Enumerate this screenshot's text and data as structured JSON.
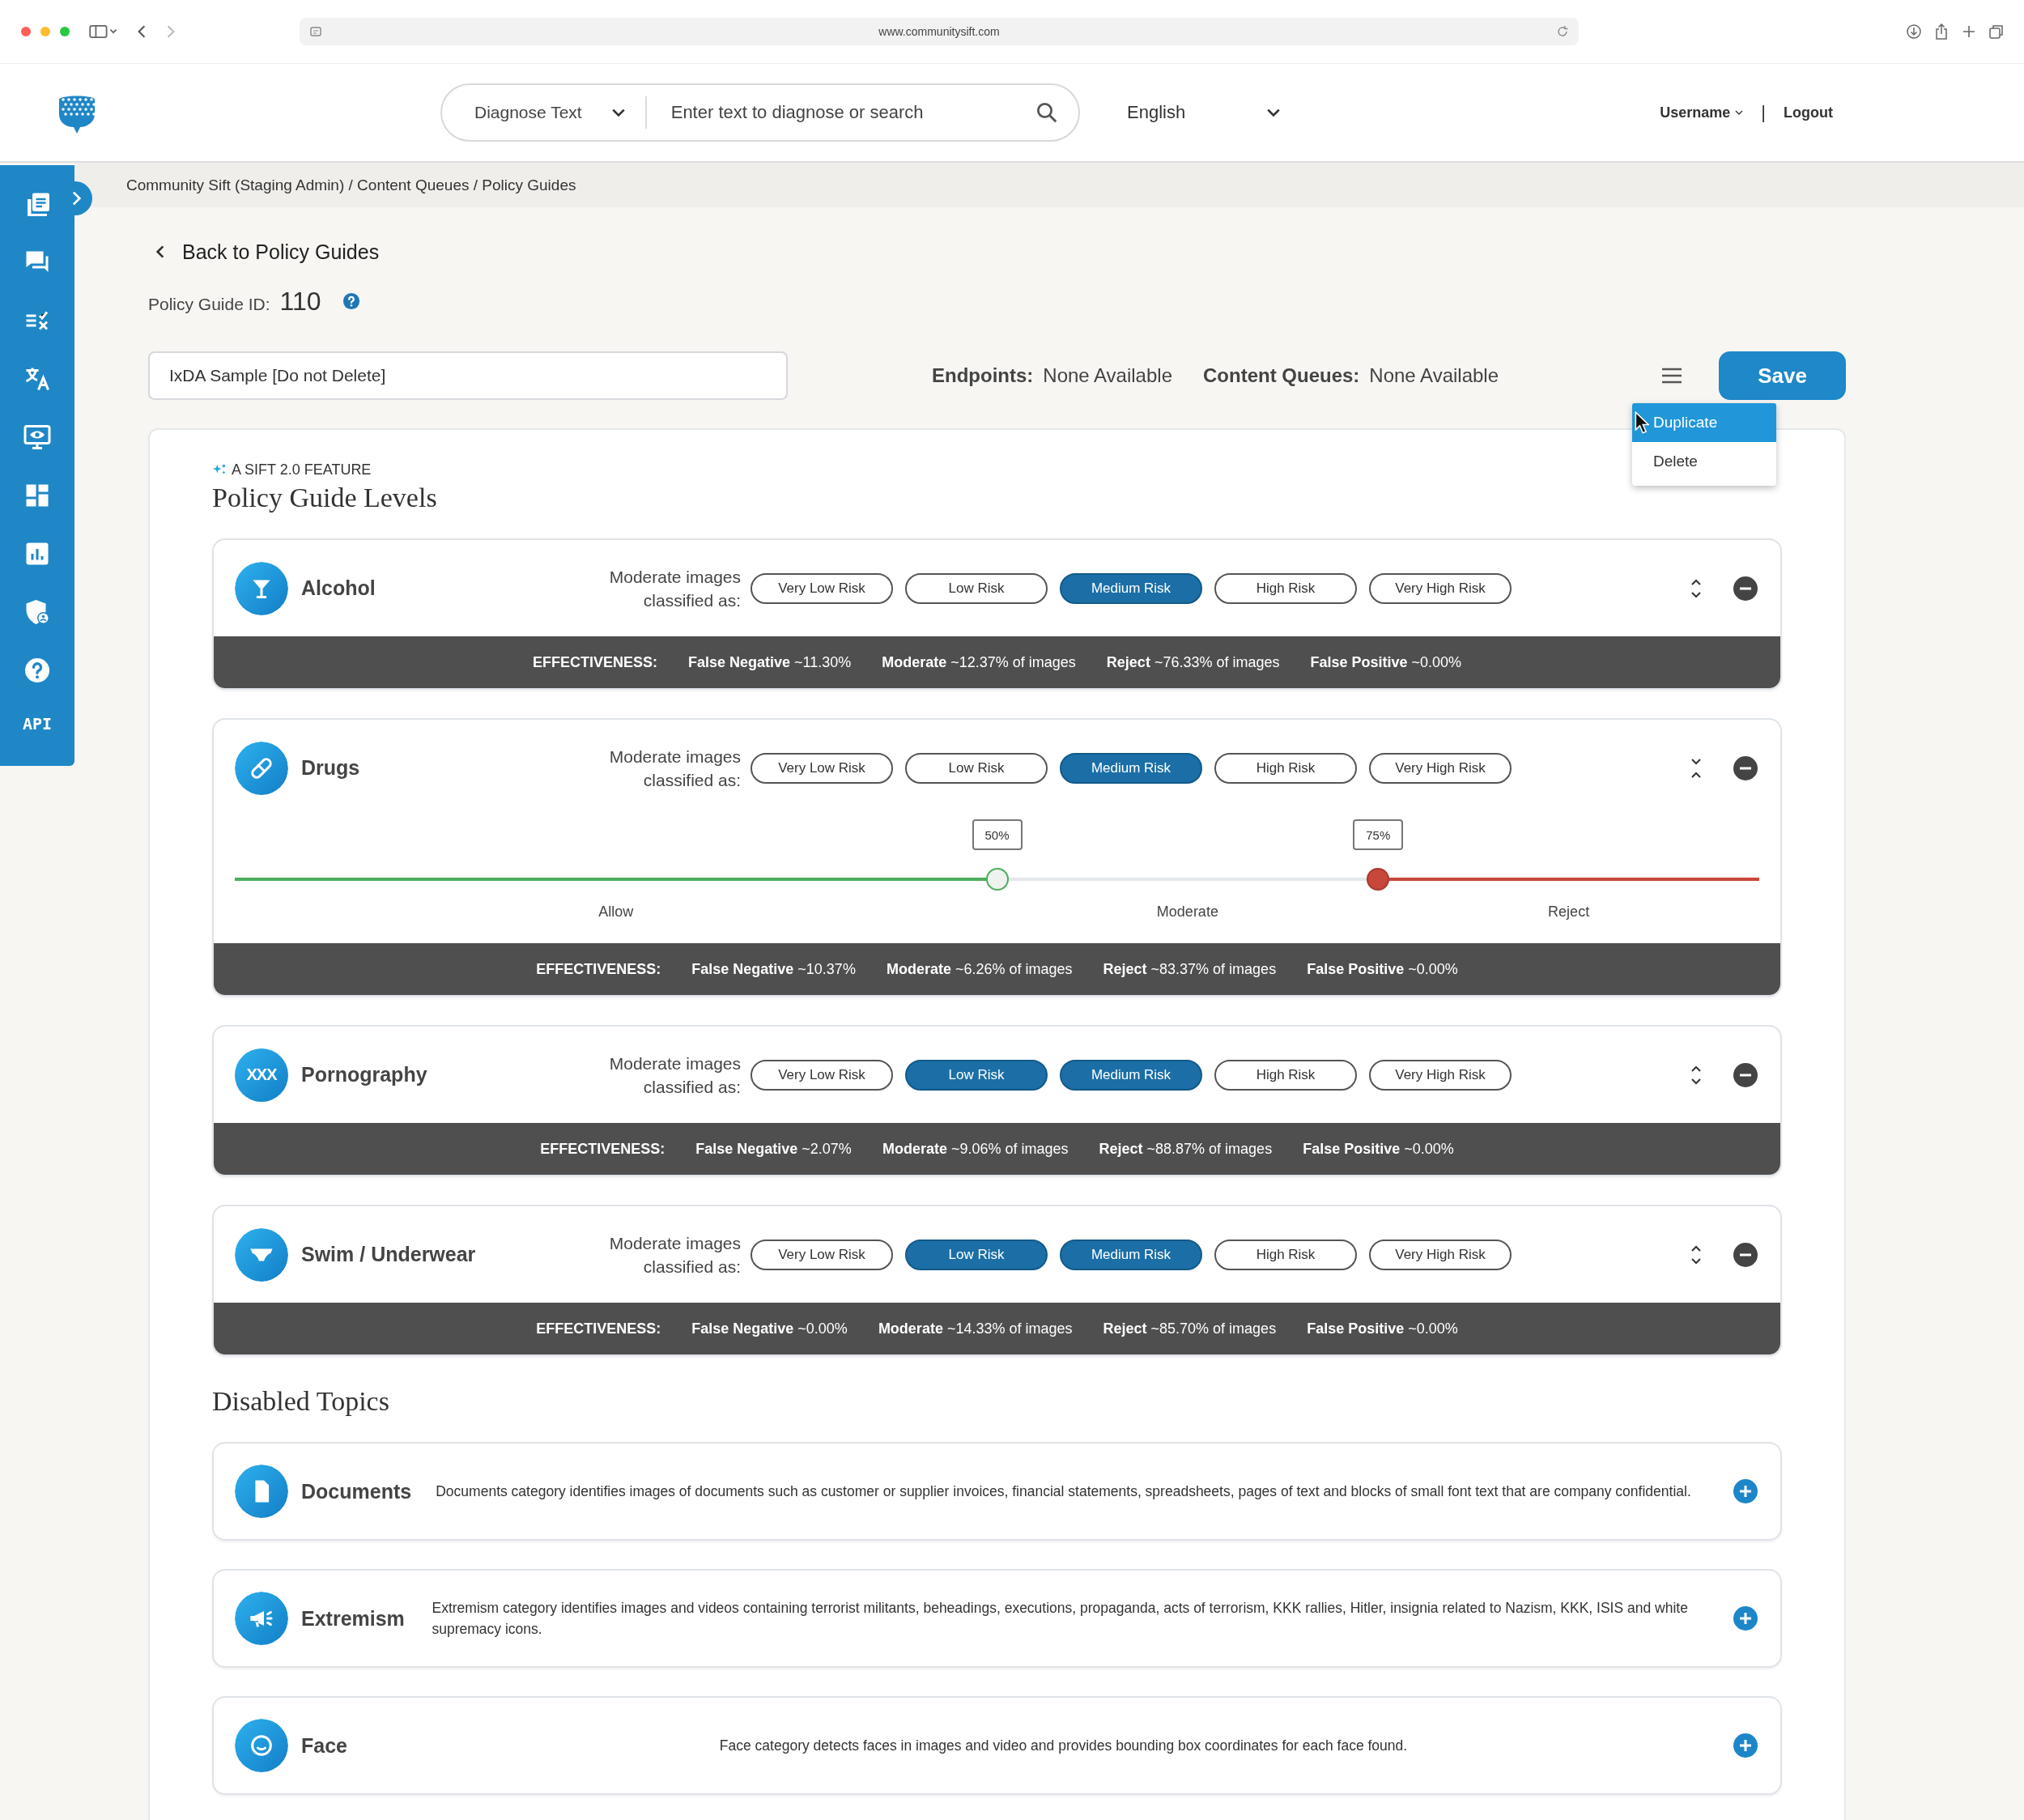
{
  "browser": {
    "url": "www.communitysift.com"
  },
  "header": {
    "diagnose_select": "Diagnose Text",
    "search": {
      "placeholder": "Enter text to diagnose or search"
    },
    "language": "English",
    "user": "Username",
    "separator": "|",
    "logout": "Logout"
  },
  "sidebar": {
    "api_label": "API"
  },
  "breadcrumb": "Community Sift (Staging Admin) / Content Queues / Policy Guides",
  "back_link": "Back to Policy Guides",
  "policy_guide_id": {
    "label": "Policy Guide ID:",
    "value": "110"
  },
  "name_field": {
    "value": "IxDA Sample [Do not Delete]"
  },
  "endpoints": {
    "label": "Endpoints:",
    "value": "None Available"
  },
  "content_queues": {
    "label": "Content Queues:",
    "value": "None Available"
  },
  "save_button": "Save",
  "menu": {
    "items": [
      {
        "label": "Duplicate",
        "selected": true
      },
      {
        "label": "Delete",
        "selected": false
      }
    ]
  },
  "levels": {
    "feature_tag": "A SIFT 2.0 FEATURE",
    "title": "Policy Guide Levels",
    "topics": [
      {
        "name": "Alcohol",
        "expanded": false,
        "classify_label": "Moderate images classified as:",
        "risks": [
          {
            "label": "Very Low Risk",
            "selected": false
          },
          {
            "label": "Low Risk",
            "selected": false
          },
          {
            "label": "Medium Risk",
            "selected": true
          },
          {
            "label": "High Risk",
            "selected": false
          },
          {
            "label": "Very High Risk",
            "selected": false
          }
        ],
        "effectiveness": {
          "label": "EFFECTIVENESS:",
          "metrics": [
            "**False Negative** ~11.30%",
            "**Moderate** ~12.37% of images",
            "**Reject** ~76.33% of images",
            "**False Positive** ~0.00%"
          ]
        }
      },
      {
        "name": "Drugs",
        "expanded": true,
        "classify_label": "Moderate images classified as:",
        "risks": [
          {
            "label": "Very Low Risk",
            "selected": false
          },
          {
            "label": "Low Risk",
            "selected": false
          },
          {
            "label": "Medium Risk",
            "selected": true
          },
          {
            "label": "High Risk",
            "selected": false
          },
          {
            "label": "Very High Risk",
            "selected": false
          }
        ],
        "slider": {
          "thresholds": [
            {
              "label": "50%",
              "level": 0.5
            },
            {
              "label": "75%",
              "level": 0.75
            }
          ],
          "zones": [
            "Allow",
            "Moderate",
            "Reject"
          ]
        },
        "effectiveness": {
          "label": "EFFECTIVENESS:",
          "metrics": [
            "**False Negative** ~10.37%",
            "**Moderate** ~6.26% of images",
            "**Reject** ~83.37% of images",
            "**False Positive** ~0.00%"
          ]
        }
      },
      {
        "name": "Pornography",
        "icon_text": "XXX",
        "expanded": false,
        "classify_label": "Moderate images classified as:",
        "risks": [
          {
            "label": "Very Low Risk",
            "selected": false
          },
          {
            "label": "Low Risk",
            "selected": true
          },
          {
            "label": "Medium Risk",
            "selected": true
          },
          {
            "label": "High Risk",
            "selected": false
          },
          {
            "label": "Very High Risk",
            "selected": false
          }
        ],
        "effectiveness": {
          "label": "EFFECTIVENESS:",
          "metrics": [
            "**False Negative** ~2.07%",
            "**Moderate** ~9.06% of images",
            "**Reject** ~88.87% of images",
            "**False Positive** ~0.00%"
          ]
        }
      },
      {
        "name": "Swim / Underwear",
        "expanded": false,
        "classify_label": "Moderate images classified as:",
        "risks": [
          {
            "label": "Very Low Risk",
            "selected": false
          },
          {
            "label": "Low Risk",
            "selected": true
          },
          {
            "label": "Medium Risk",
            "selected": true
          },
          {
            "label": "High Risk",
            "selected": false
          },
          {
            "label": "Very High Risk",
            "selected": false
          }
        ],
        "effectiveness": {
          "label": "EFFECTIVENESS:",
          "metrics": [
            "**False Negative** ~0.00%",
            "**Moderate** ~14.33% of images",
            "**Reject** ~85.70% of images",
            "**False Positive** ~0.00%"
          ]
        }
      }
    ]
  },
  "disabled": {
    "title": "Disabled Topics",
    "topics": [
      {
        "name": "Documents",
        "description": "Documents category identifies images of documents such as customer or supplier invoices, financial statements, spreadsheets, pages of text and blocks of small font text that are company confidential."
      },
      {
        "name": "Extremism",
        "description": "Extremism category identifies images and videos containing terrorist militants, beheadings, executions, propaganda, acts of terrorism, KKK rallies, Hitler, insignia related to Nazism, KKK, ISIS and white supremacy icons."
      },
      {
        "name": "Face",
        "description": "Face category detects faces in images and video and provides bounding box coordinates for each face found."
      }
    ]
  }
}
